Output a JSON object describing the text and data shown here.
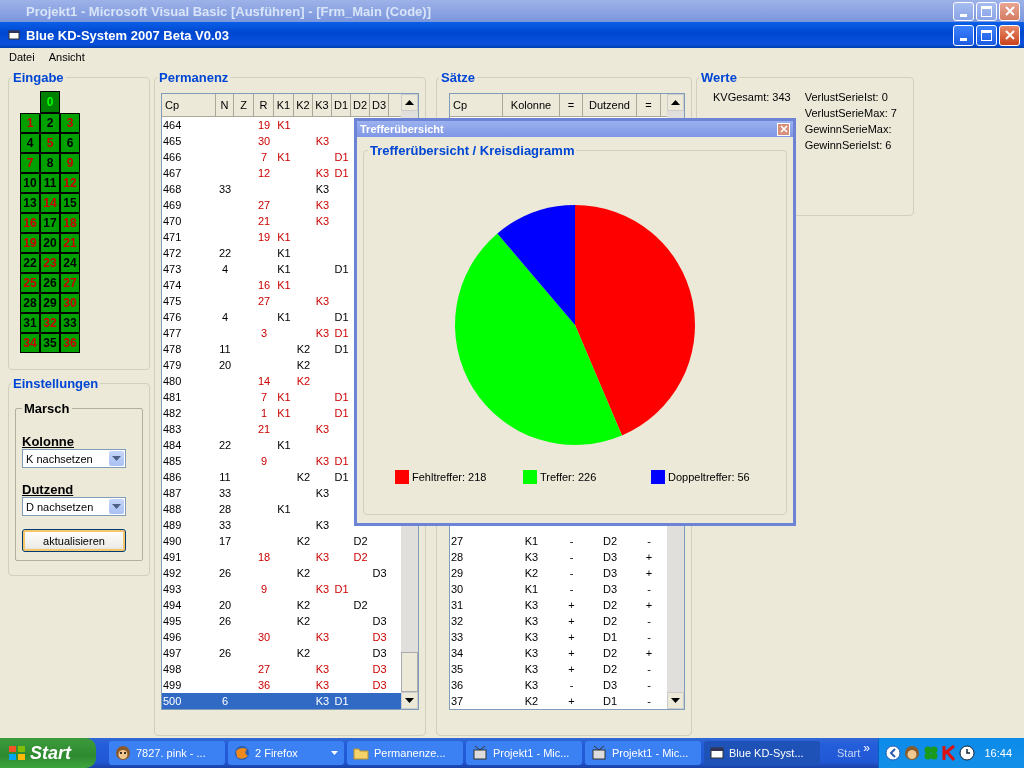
{
  "background_window": {
    "title": "Projekt1 - Microsoft Visual Basic [Ausführen] - [Frm_Main (Code)]"
  },
  "window": {
    "title": "Blue KD-System 2007 Beta V0.03"
  },
  "menu": [
    "Datei",
    "Ansicht"
  ],
  "eingabe": {
    "title": "Eingabe",
    "zero": {
      "label": "0",
      "kind": "zero"
    },
    "numbers": [
      {
        "label": "1",
        "kind": "rot"
      },
      {
        "label": "2",
        "kind": "schwarz"
      },
      {
        "label": "3",
        "kind": "rot"
      },
      {
        "label": "4",
        "kind": "schwarz"
      },
      {
        "label": "5",
        "kind": "rot"
      },
      {
        "label": "6",
        "kind": "schwarz"
      },
      {
        "label": "7",
        "kind": "rot"
      },
      {
        "label": "8",
        "kind": "schwarz"
      },
      {
        "label": "9",
        "kind": "rot"
      },
      {
        "label": "10",
        "kind": "schwarz"
      },
      {
        "label": "11",
        "kind": "schwarz"
      },
      {
        "label": "12",
        "kind": "rot"
      },
      {
        "label": "13",
        "kind": "schwarz"
      },
      {
        "label": "14",
        "kind": "rot"
      },
      {
        "label": "15",
        "kind": "schwarz"
      },
      {
        "label": "16",
        "kind": "rot"
      },
      {
        "label": "17",
        "kind": "schwarz"
      },
      {
        "label": "18",
        "kind": "rot"
      },
      {
        "label": "19",
        "kind": "rot"
      },
      {
        "label": "20",
        "kind": "schwarz"
      },
      {
        "label": "21",
        "kind": "rot"
      },
      {
        "label": "22",
        "kind": "schwarz"
      },
      {
        "label": "23",
        "kind": "rot"
      },
      {
        "label": "24",
        "kind": "schwarz"
      },
      {
        "label": "25",
        "kind": "rot"
      },
      {
        "label": "26",
        "kind": "schwarz"
      },
      {
        "label": "27",
        "kind": "rot"
      },
      {
        "label": "28",
        "kind": "schwarz"
      },
      {
        "label": "29",
        "kind": "schwarz"
      },
      {
        "label": "30",
        "kind": "rot"
      },
      {
        "label": "31",
        "kind": "schwarz"
      },
      {
        "label": "32",
        "kind": "rot"
      },
      {
        "label": "33",
        "kind": "schwarz"
      },
      {
        "label": "34",
        "kind": "rot"
      },
      {
        "label": "35",
        "kind": "schwarz"
      },
      {
        "label": "36",
        "kind": "rot"
      }
    ]
  },
  "einstellungen": {
    "title": "Einstellungen",
    "marsch": {
      "title": "Marsch",
      "fields": [
        {
          "label": "Kolonne",
          "value": "K nachsetzen"
        },
        {
          "label": "Dutzend",
          "value": "D nachsetzen"
        }
      ],
      "button": "aktualisieren"
    }
  },
  "permanenz": {
    "title": "Permanenz",
    "columns": [
      "Cp",
      "N",
      "Z",
      "R",
      "K1",
      "K2",
      "K3",
      "D1",
      "D2",
      "D3"
    ],
    "rows": [
      {
        "cp": "464",
        "r": "19",
        "k1": "K1",
        "selected": false
      },
      {
        "cp": "465",
        "r": "30",
        "k3": "K3",
        "selected": false
      },
      {
        "cp": "466",
        "r": "7",
        "k1": "K1",
        "d1": "D1",
        "selected": false
      },
      {
        "cp": "467",
        "r": "12",
        "k3": "K3",
        "d1": "D1",
        "selected": false
      },
      {
        "cp": "468",
        "n": "33",
        "k3": "K3",
        "selected": false
      },
      {
        "cp": "469",
        "r": "27",
        "k3": "K3",
        "selected": false
      },
      {
        "cp": "470",
        "r": "21",
        "k3": "K3",
        "selected": false
      },
      {
        "cp": "471",
        "r": "19",
        "k1": "K1",
        "selected": false
      },
      {
        "cp": "472",
        "n": "22",
        "k1": "K1",
        "selected": false
      },
      {
        "cp": "473",
        "n": "4",
        "k1": "K1",
        "d1": "D1",
        "selected": false
      },
      {
        "cp": "474",
        "r": "16",
        "k1": "K1",
        "selected": false
      },
      {
        "cp": "475",
        "r": "27",
        "k3": "K3",
        "selected": false
      },
      {
        "cp": "476",
        "n": "4",
        "k1": "K1",
        "d1": "D1",
        "selected": false
      },
      {
        "cp": "477",
        "r": "3",
        "k3": "K3",
        "d1": "D1",
        "selected": false
      },
      {
        "cp": "478",
        "n": "11",
        "k2": "K2",
        "d1": "D1",
        "selected": false
      },
      {
        "cp": "479",
        "n": "20",
        "k2": "K2",
        "selected": false
      },
      {
        "cp": "480",
        "r": "14",
        "k2": "K2",
        "selected": false
      },
      {
        "cp": "481",
        "r": "7",
        "k1": "K1",
        "d1": "D1",
        "selected": false
      },
      {
        "cp": "482",
        "r": "1",
        "k1": "K1",
        "d1": "D1",
        "selected": false
      },
      {
        "cp": "483",
        "r": "21",
        "k3": "K3",
        "selected": false
      },
      {
        "cp": "484",
        "n": "22",
        "k1": "K1",
        "selected": false
      },
      {
        "cp": "485",
        "r": "9",
        "k3": "K3",
        "d1": "D1",
        "selected": false
      },
      {
        "cp": "486",
        "n": "11",
        "k2": "K2",
        "d1": "D1",
        "selected": false
      },
      {
        "cp": "487",
        "n": "33",
        "k3": "K3",
        "selected": false
      },
      {
        "cp": "488",
        "n": "28",
        "k1": "K1",
        "selected": false
      },
      {
        "cp": "489",
        "n": "33",
        "k3": "K3",
        "selected": false
      },
      {
        "cp": "490",
        "n": "17",
        "k2": "K2",
        "d2": "D2",
        "selected": false
      },
      {
        "cp": "491",
        "r": "18",
        "k3": "K3",
        "d2": "D2",
        "selected": false
      },
      {
        "cp": "492",
        "n": "26",
        "k2": "K2",
        "d3": "D3",
        "selected": false
      },
      {
        "cp": "493",
        "r": "9",
        "k3": "K3",
        "d1": "D1",
        "selected": false
      },
      {
        "cp": "494",
        "n": "20",
        "k2": "K2",
        "d2": "D2",
        "selected": false
      },
      {
        "cp": "495",
        "n": "26",
        "k2": "K2",
        "d3": "D3",
        "selected": false
      },
      {
        "cp": "496",
        "r": "30",
        "k3": "K3",
        "d3": "D3",
        "selected": false
      },
      {
        "cp": "497",
        "n": "26",
        "k2": "K2",
        "d3": "D3",
        "selected": false
      },
      {
        "cp": "498",
        "r": "27",
        "k3": "K3",
        "d3": "D3",
        "selected": false
      },
      {
        "cp": "499",
        "r": "36",
        "k3": "K3",
        "d3": "D3",
        "selected": false
      },
      {
        "cp": "500",
        "n": "6",
        "k3": "K3",
        "d1": "D1",
        "selected": true
      }
    ]
  },
  "saetze": {
    "title": "Sätze",
    "columns": [
      "Cp",
      "Kolonne",
      "=",
      "Dutzend",
      "="
    ],
    "rows": [
      {
        "cp": "27",
        "kolonne": "K1",
        "k_eq": "-",
        "dutzend": "D2",
        "d_eq": "-"
      },
      {
        "cp": "28",
        "kolonne": "K3",
        "k_eq": "-",
        "dutzend": "D3",
        "d_eq": "+"
      },
      {
        "cp": "29",
        "kolonne": "K2",
        "k_eq": "-",
        "dutzend": "D3",
        "d_eq": "+"
      },
      {
        "cp": "30",
        "kolonne": "K1",
        "k_eq": "-",
        "dutzend": "D3",
        "d_eq": "-"
      },
      {
        "cp": "31",
        "kolonne": "K3",
        "k_eq": "+",
        "dutzend": "D2",
        "d_eq": "+"
      },
      {
        "cp": "32",
        "kolonne": "K3",
        "k_eq": "+",
        "dutzend": "D2",
        "d_eq": "-"
      },
      {
        "cp": "33",
        "kolonne": "K3",
        "k_eq": "+",
        "dutzend": "D1",
        "d_eq": "-"
      },
      {
        "cp": "34",
        "kolonne": "K3",
        "k_eq": "+",
        "dutzend": "D2",
        "d_eq": "+"
      },
      {
        "cp": "35",
        "kolonne": "K3",
        "k_eq": "+",
        "dutzend": "D2",
        "d_eq": "-"
      },
      {
        "cp": "36",
        "kolonne": "K3",
        "k_eq": "-",
        "dutzend": "D3",
        "d_eq": "-"
      },
      {
        "cp": "37",
        "kolonne": "K2",
        "k_eq": "+",
        "dutzend": "D1",
        "d_eq": "-"
      }
    ]
  },
  "werte": {
    "title": "Werte",
    "column_1": [
      "KVGesamt: 343"
    ],
    "column_2": [
      "VerlustSerieIst: 0",
      "VerlustSerieMax: 7",
      "GewinnSerieMax:",
      "GewinnSerieIst: 6"
    ]
  },
  "dialog": {
    "title": "Trefferübersicht",
    "group_title": "Trefferübersicht / Kreisdiagramm",
    "chart_data": {
      "type": "pie",
      "categories": [
        "Fehltreffer: 218",
        "Treffer: 226",
        "Doppeltreffer: 56"
      ],
      "values": [
        218,
        226,
        56
      ]
    },
    "legend": [
      {
        "color": "#ff0000"
      },
      {
        "color": "#00ff00"
      },
      {
        "color": "#0000ff"
      }
    ]
  },
  "taskbar": {
    "start": "Start",
    "items": [
      {
        "label": "7827. pink - ...",
        "kind": "monkey",
        "selected": false
      },
      {
        "label": "2 Firefox",
        "kind": "browser",
        "selected": false,
        "dropdown": true
      },
      {
        "label": "Permanenze...",
        "kind": "folder",
        "selected": false
      },
      {
        "label": "Projekt1 - Mic...",
        "kind": "program",
        "selected": false
      },
      {
        "label": "Projekt1 - Mic...",
        "kind": "program",
        "selected": false
      },
      {
        "label": "Blue KD-Syst...",
        "kind": "window",
        "selected": true
      }
    ],
    "quick_launch": "Start",
    "chevron": "»",
    "clock": "16:44"
  }
}
